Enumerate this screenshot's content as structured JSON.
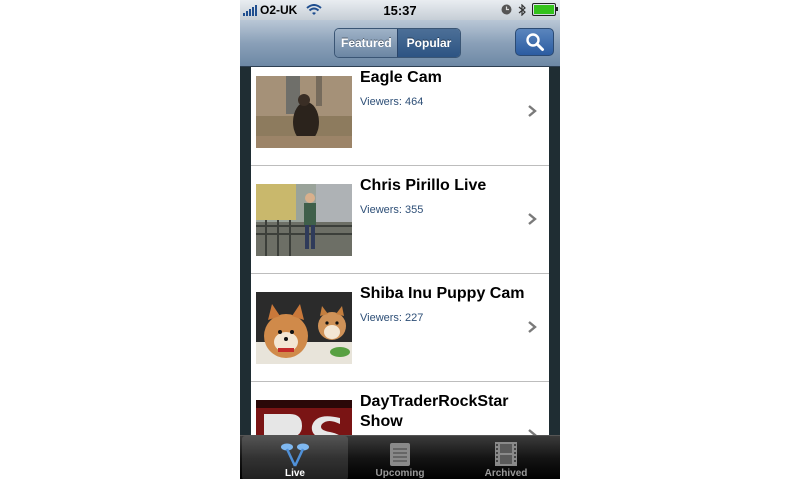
{
  "status_bar": {
    "carrier": "O2-UK",
    "time": "15:37",
    "battery_color": "#34c21b"
  },
  "nav_bar": {
    "segments": [
      {
        "label": "Featured",
        "selected": false
      },
      {
        "label": "Popular",
        "selected": true
      }
    ],
    "search_icon": "search-icon"
  },
  "list": {
    "items": [
      {
        "title": "Eagle Cam",
        "viewers": "Viewers: 464"
      },
      {
        "title": "Chris Pirillo Live",
        "viewers": "Viewers: 355"
      },
      {
        "title": "Shiba Inu Puppy Cam",
        "viewers": "Viewers: 227"
      },
      {
        "title": "DayTraderRockStar Show",
        "viewers": ""
      }
    ]
  },
  "tab_bar": {
    "tabs": [
      {
        "label": "Live",
        "icon": "live-icon",
        "selected": true
      },
      {
        "label": "Upcoming",
        "icon": "calendar-icon",
        "selected": false
      },
      {
        "label": "Archived",
        "icon": "film-icon",
        "selected": false
      }
    ]
  },
  "colors": {
    "accent": "#2d5483",
    "viewers_text": "#2e4f77"
  }
}
